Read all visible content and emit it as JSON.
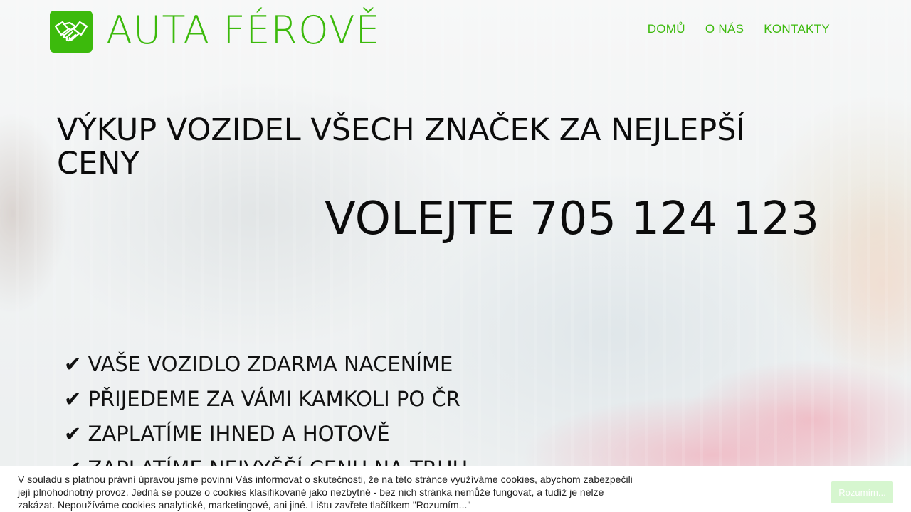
{
  "brand": {
    "name": "AUTA FÉROVĚ",
    "icon": "handshake-icon",
    "color": "#3cba0c"
  },
  "nav": {
    "items": [
      {
        "label": "DOMŮ"
      },
      {
        "label": "O NÁS"
      },
      {
        "label": "KONTAKTY"
      }
    ]
  },
  "hero": {
    "headline": "VÝKUP VOZIDEL VŠECH ZNAČEK ZA NEJLEPŠÍ CENY",
    "phone_cta": "VOLEJTE 705 124 123",
    "benefits": [
      "✔ VAŠE VOZIDLO ZDARMA NACENÍME",
      "✔ PŘIJEDEME ZA VÁMI KAMKOLI PO ČR",
      "✔ ZAPLATÍME IHNED A HOTOVĚ",
      "✔ ZAPLATÍME NEJVYŠŠÍ CENU NA TRHU"
    ]
  },
  "cookie_bar": {
    "text": "V souladu s platnou právní úpravou jsme povinni Vás informovat o skutečnosti, že na této stránce využíváme cookies, abychom zabezpečili její plnohodnotný provoz. Jedná se pouze o cookies klasifikované jako nezbytné - bez nich stránka nemůže fungovat, a tudíž je nelze zakázat. Nepoužíváme cookies analytické, marketingové, ani jiné. Lištu zavřete tlačítkem \"Rozumím...\"",
    "button_label": "Rozumím..."
  }
}
